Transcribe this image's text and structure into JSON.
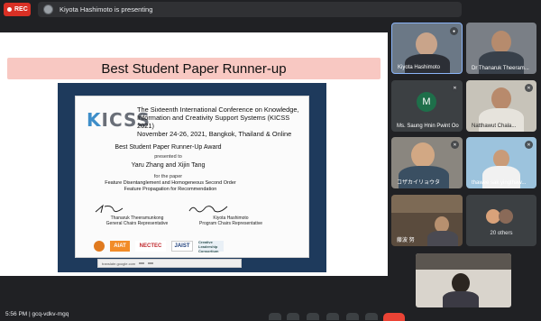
{
  "topbar": {
    "rec_label": "REC",
    "presenting_text": "Kiyota Hashimoto is presenting"
  },
  "slide": {
    "banner": "Best Student Paper Runner-up",
    "logo_text": "KICSS",
    "conference_title": "The Sixteenth International Conference on Knowledge, Information and Creativity Support Systems (KICSS 2021)",
    "conference_date": "November 24-26, 2021, Bangkok, Thailand & Online",
    "award_title": "Best Student Paper Runner-Up Award",
    "presented_to": "presented to",
    "authors": "Yaru Zhang and Xijin Tang",
    "for_paper": "for the paper",
    "paper_title": "Feature Disentanglement and Homogeneous Second Order Feature Propagation for Recommendation",
    "signatories": [
      {
        "name": "Thanaruk Theeramunkong",
        "role": "General Chairs Representative"
      },
      {
        "name": "Kiyota Hashimoto",
        "role": "Program Chairs Representative"
      }
    ],
    "sponsors": [
      "",
      "AiAT",
      "NECTEC",
      "JAIST",
      "Creative Leadership Consortium"
    ],
    "translate_bar": {
      "text": "translate.google.com",
      "button1": "",
      "button2": ""
    }
  },
  "participants": [
    {
      "name": "Kiyota Hashimoto",
      "speaking": true
    },
    {
      "name": "Dr Thanaruk Theeram..."
    },
    {
      "name": "Ms. Saung Hnin Pwint Oo",
      "initial": "M"
    },
    {
      "name": "Natthawut Chala..."
    },
    {
      "name": "コザカイリョウタ"
    },
    {
      "name": "thawee sak yingthaw..."
    },
    {
      "name": "藤波 努"
    },
    {
      "name": "20 others"
    },
    {
      "name": ""
    }
  ],
  "bottom": {
    "clock": "5:56 PM | gcq-vdkv-mgq"
  },
  "colors": {
    "rec": "#d93025",
    "banner": "#f8c8c2",
    "certificate_frame": "#1e3a5c",
    "end_call": "#ea4335",
    "active_speaker_border": "#8ab4f8"
  }
}
